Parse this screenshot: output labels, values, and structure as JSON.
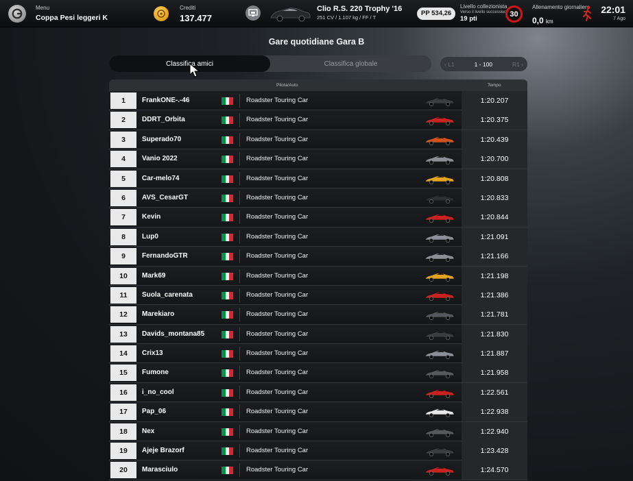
{
  "header": {
    "menu_label": "Menu",
    "menu_title": "Coppa Pesi leggeri K",
    "credits_label": "Crediti",
    "credits_value": "137.477",
    "car_name": "Clio R.S. 220 Trophy '16",
    "car_specs": "251 CV / 1.107 kg / FF / T",
    "pp": "PP 534,26",
    "level_label": "Livello collezionista",
    "level_sub": "Verso il livello successivo",
    "level_points": "19 pti",
    "level_number": "30",
    "daily_label": "Allenamento giornaliero",
    "daily_value": "0,0",
    "daily_unit": "km",
    "time": "22:01",
    "date": "7 Ago"
  },
  "page": {
    "title": "Gare quotidiane Gara B",
    "tab_friends": "Classifica amici",
    "tab_global": "Classifica globale",
    "pager_prev": "‹ L1",
    "pager_range": "1 - 100",
    "pager_next": "R1 ›"
  },
  "table": {
    "col_driver": "Pilota/Auto",
    "col_time": "Tempo",
    "rows": [
      {
        "pos": "1",
        "name": "FrankONE-.-46",
        "car": "Roadster Touring Car",
        "time": "1:20.207",
        "car_color": "#3a3c40"
      },
      {
        "pos": "2",
        "name": "DDRT_Orbita",
        "car": "Roadster Touring Car",
        "time": "1:20.375",
        "car_color": "#c9231f"
      },
      {
        "pos": "3",
        "name": "Superado70",
        "car": "Roadster Touring Car",
        "time": "1:20.439",
        "car_color": "#d2521e"
      },
      {
        "pos": "4",
        "name": "Vanio 2022",
        "car": "Roadster Touring Car",
        "time": "1:20.700",
        "car_color": "#8a9096"
      },
      {
        "pos": "5",
        "name": "Car-melo74",
        "car": "Roadster Touring Car",
        "time": "1:20.808",
        "car_color": "#e3a31c"
      },
      {
        "pos": "6",
        "name": "AVS_CesarGT",
        "car": "Roadster Touring Car",
        "time": "1:20.833",
        "car_color": "#2c2e31"
      },
      {
        "pos": "7",
        "name": "Kevin",
        "car": "Roadster Touring Car",
        "time": "1:20.844",
        "car_color": "#c9231f"
      },
      {
        "pos": "8",
        "name": "Lup0",
        "car": "Roadster Touring Car",
        "time": "1:21.091",
        "car_color": "#8a9096"
      },
      {
        "pos": "9",
        "name": "FernandoGTR",
        "car": "Roadster Touring Car",
        "time": "1:21.166",
        "car_color": "#8a9096"
      },
      {
        "pos": "10",
        "name": "Mark69",
        "car": "Roadster Touring Car",
        "time": "1:21.198",
        "car_color": "#e3a31c"
      },
      {
        "pos": "11",
        "name": "Suola_carenata",
        "car": "Roadster Touring Car",
        "time": "1:21.386",
        "car_color": "#c9231f"
      },
      {
        "pos": "12",
        "name": "Marekiaro",
        "car": "Roadster Touring Car",
        "time": "1:21.781",
        "car_color": "#55585d"
      },
      {
        "pos": "13",
        "name": "Davids_montana85",
        "car": "Roadster Touring Car",
        "time": "1:21.830",
        "car_color": "#3a3c40"
      },
      {
        "pos": "14",
        "name": "Crix13",
        "car": "Roadster Touring Car",
        "time": "1:21.887",
        "car_color": "#8a9096"
      },
      {
        "pos": "15",
        "name": "Fumone",
        "car": "Roadster Touring Car",
        "time": "1:21.958",
        "car_color": "#55585d"
      },
      {
        "pos": "16",
        "name": "i_no_cool",
        "car": "Roadster Touring Car",
        "time": "1:22.561",
        "car_color": "#c9231f"
      },
      {
        "pos": "17",
        "name": "Pap_06",
        "car": "Roadster Touring Car",
        "time": "1:22.938",
        "car_color": "#e6e6e6"
      },
      {
        "pos": "18",
        "name": "Nex",
        "car": "Roadster Touring Car",
        "time": "1:22.940",
        "car_color": "#55585d"
      },
      {
        "pos": "19",
        "name": "Ajeje Brazorf",
        "car": "Roadster Touring Car",
        "time": "1:23.428",
        "car_color": "#3a3c40"
      },
      {
        "pos": "20",
        "name": "Marasciulo",
        "car": "Roadster Touring Car",
        "time": "1:24.570",
        "car_color": "#c9231f"
      }
    ]
  },
  "colors": {
    "flag_green": "#009246",
    "flag_white": "#f1f2f1",
    "flag_red": "#ce2b37",
    "level_ring": "#d01717",
    "credits_coin": "#f0a51a"
  }
}
